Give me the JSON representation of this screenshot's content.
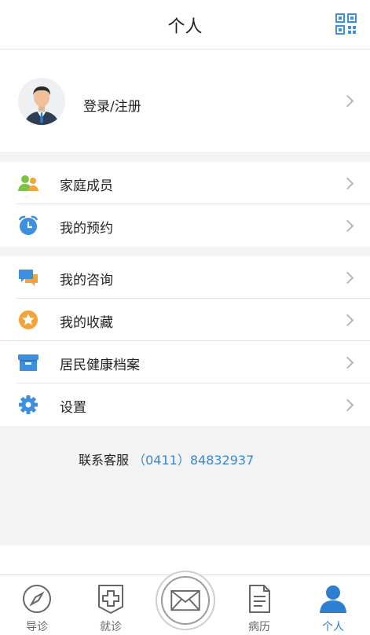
{
  "header": {
    "title": "个人",
    "qr_icon": "qrcode-icon"
  },
  "profile": {
    "login_label": "登录/注册",
    "avatar_icon": "avatar-icon"
  },
  "menu_group1": [
    {
      "label": "家庭成员",
      "icon": "family-members-icon"
    },
    {
      "label": "我的预约",
      "icon": "alarm-clock-icon"
    }
  ],
  "menu_group2": [
    {
      "label": "我的咨询",
      "icon": "chat-bubbles-icon"
    },
    {
      "label": "我的收藏",
      "icon": "star-icon"
    },
    {
      "label": "居民健康档案",
      "icon": "archive-box-icon"
    },
    {
      "label": "设置",
      "icon": "gear-icon"
    }
  ],
  "service": {
    "label": "联系客服",
    "phone": "（0411）84832937"
  },
  "tabbar": {
    "tabs": [
      {
        "label": "导诊",
        "icon": "compass-icon"
      },
      {
        "label": "就诊",
        "icon": "medical-cross-icon"
      },
      {
        "label": "",
        "icon": "envelope-icon"
      },
      {
        "label": "病历",
        "icon": "document-icon"
      },
      {
        "label": "个人",
        "icon": "person-icon"
      }
    ],
    "active": "个人"
  },
  "colors": {
    "accent": "#2f7fd0",
    "blue_icon": "#3d8fe0",
    "orange_icon": "#f5a236",
    "green_icon": "#7cc243"
  }
}
